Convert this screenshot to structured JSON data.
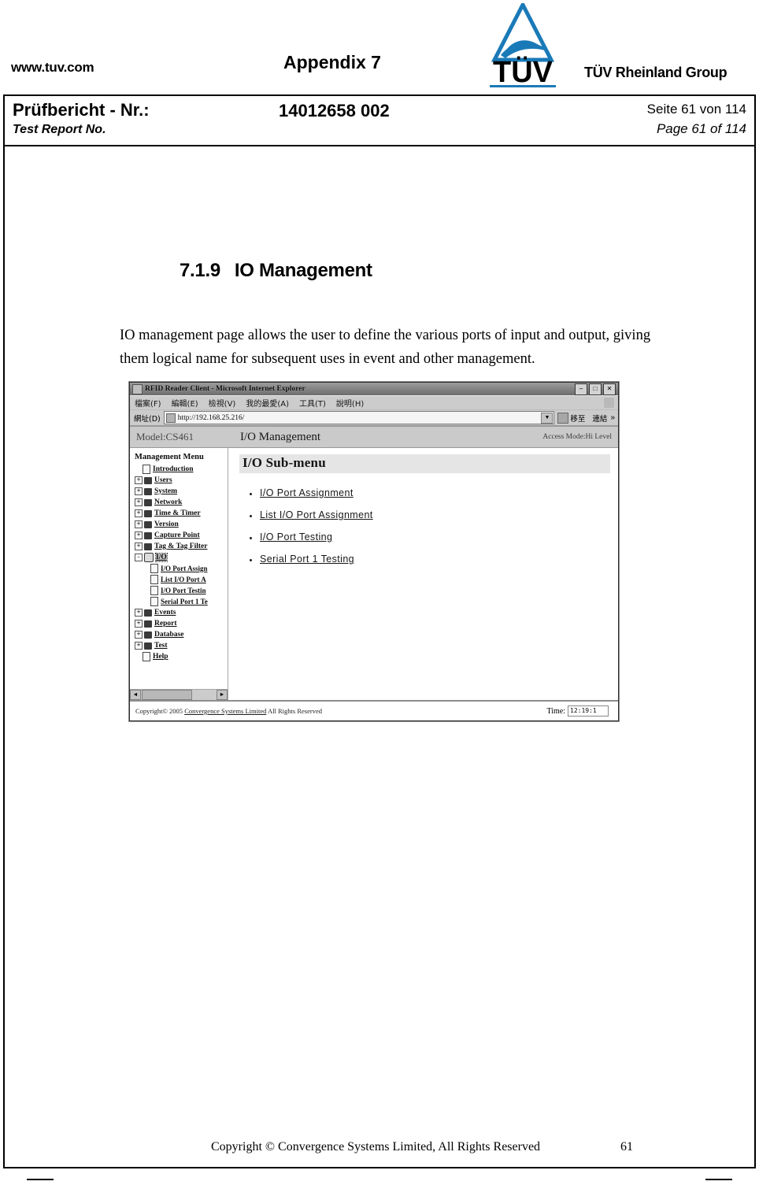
{
  "header": {
    "url": "www.tuv.com",
    "appendix": "Appendix 7",
    "logo_wordmark": "TÜV",
    "group_name": "TÜV Rheinland Group"
  },
  "report_box": {
    "label_de": "Prüfbericht - Nr.:",
    "label_en": "Test Report No.",
    "number": "14012658 002",
    "page_de": "Seite 61 von 114",
    "page_en": "Page 61 of 114"
  },
  "section": {
    "number": "7.1.9",
    "title": "IO Management",
    "paragraph": "IO management page allows the user to define the various ports of input and output, giving them logical name for subsequent uses in event and other management."
  },
  "browser": {
    "title": "RFID Reader Client - Microsoft Internet Explorer",
    "win_minimize": "–",
    "win_maximize": "□",
    "win_close": "✕",
    "menus": [
      "檔案(F)",
      "編輯(E)",
      "檢視(V)",
      "我的最愛(A)",
      "工具(T)",
      "說明(H)"
    ],
    "address_label": "網址(D)",
    "address_value": "http://192.168.25.216/",
    "go_label": "移至",
    "links_label": "連結",
    "chevron": "»"
  },
  "app": {
    "model": "Model:CS461",
    "title": "I/O Management",
    "access_mode": "Access Mode:Hi Level"
  },
  "tree": {
    "title": "Management Menu",
    "items": [
      {
        "label": "Introduction",
        "icon": "page-icon",
        "expander": "",
        "level": 1
      },
      {
        "label": "Users",
        "icon": "folder-icon",
        "expander": "+",
        "level": 1
      },
      {
        "label": "System",
        "icon": "folder-icon",
        "expander": "+",
        "level": 1
      },
      {
        "label": "Network",
        "icon": "folder-icon",
        "expander": "+",
        "level": 1
      },
      {
        "label": "Time & Timer",
        "icon": "folder-icon",
        "expander": "+",
        "level": 1
      },
      {
        "label": "Version",
        "icon": "folder-icon",
        "expander": "+",
        "level": 1
      },
      {
        "label": "Capture Point",
        "icon": "folder-icon",
        "expander": "+",
        "level": 1
      },
      {
        "label": "Tag & Tag Filter",
        "icon": "folder-icon",
        "expander": "+",
        "level": 1
      },
      {
        "label": "I/O",
        "icon": "io-icon",
        "expander": "–",
        "level": 1,
        "selected": true
      },
      {
        "label": "I/O Port Assign",
        "icon": "page-icon",
        "expander": "",
        "level": 2
      },
      {
        "label": "List I/O Port A",
        "icon": "page-icon",
        "expander": "",
        "level": 2
      },
      {
        "label": "I/O Port Testin",
        "icon": "page-icon",
        "expander": "",
        "level": 2
      },
      {
        "label": "Serial Port 1 Te",
        "icon": "page-icon",
        "expander": "",
        "level": 2
      },
      {
        "label": "Events",
        "icon": "folder-icon",
        "expander": "+",
        "level": 1
      },
      {
        "label": "Report",
        "icon": "folder-icon",
        "expander": "+",
        "level": 1
      },
      {
        "label": "Database",
        "icon": "folder-icon",
        "expander": "+",
        "level": 1
      },
      {
        "label": "Test",
        "icon": "folder-icon",
        "expander": "+",
        "level": 1
      },
      {
        "label": "Help",
        "icon": "page-icon",
        "expander": "",
        "level": 1
      }
    ],
    "scroll_left": "◄",
    "scroll_right": "►"
  },
  "submenu": {
    "title": "I/O Sub-menu",
    "links": [
      "I/O  Port  Assignment",
      "List  I/O  Port  Assignment",
      "I/O  Port  Testing",
      "Serial  Port  1  Testing"
    ]
  },
  "browser_footer": {
    "copyright_prefix": "Copyright© 2005 ",
    "copyright_company": "Convergence Systems Limited",
    "copyright_suffix": "  All Rights Reserved",
    "time_label": "Time:",
    "time_value": "12:19:1"
  },
  "doc_footer": {
    "text": "Copyright © Convergence Systems Limited, All Rights Reserved",
    "page": "61"
  }
}
